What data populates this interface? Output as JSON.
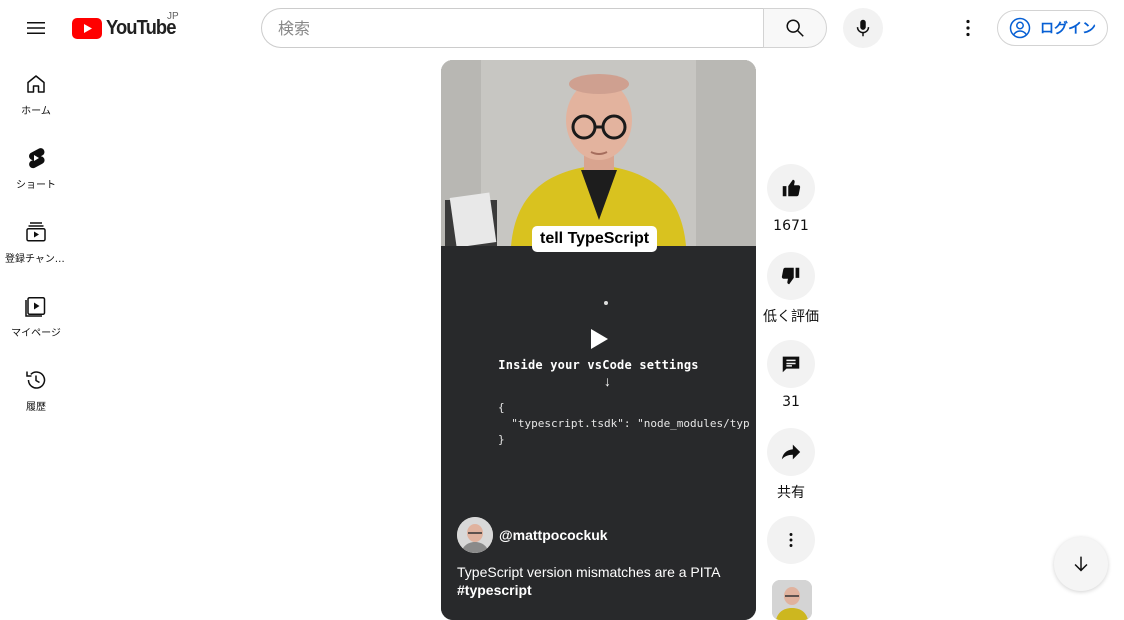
{
  "masthead": {
    "logo_text": "YouTube",
    "country_code": "JP",
    "search_placeholder": "検索",
    "login_label": "ログイン"
  },
  "guide": {
    "items": [
      {
        "label": "ホーム",
        "icon": "home-icon"
      },
      {
        "label": "ショート",
        "icon": "shorts-icon"
      },
      {
        "label": "登録チャンネル",
        "icon": "subscriptions-icon"
      },
      {
        "label": "マイページ",
        "icon": "library-icon"
      },
      {
        "label": "履歴",
        "icon": "history-icon"
      }
    ]
  },
  "short": {
    "caption_overlay": "tell TypeScript",
    "screen_text": "Inside your vsCode settings",
    "code_lines": [
      "{",
      "  \"typescript.tsdk\": \"node_modules/typ",
      "}"
    ],
    "channel_handle": "@mattpocockuk",
    "title": "TypeScript version mismatches are a PITA",
    "hashtag": "#typescript"
  },
  "actions": {
    "like_count": "1671",
    "dislike_label": "低く評価",
    "comment_count": "31",
    "share_label": "共有"
  },
  "colors": {
    "brand_red": "#ff0000",
    "link_blue": "#065fd4",
    "player_bg": "#28292b"
  }
}
